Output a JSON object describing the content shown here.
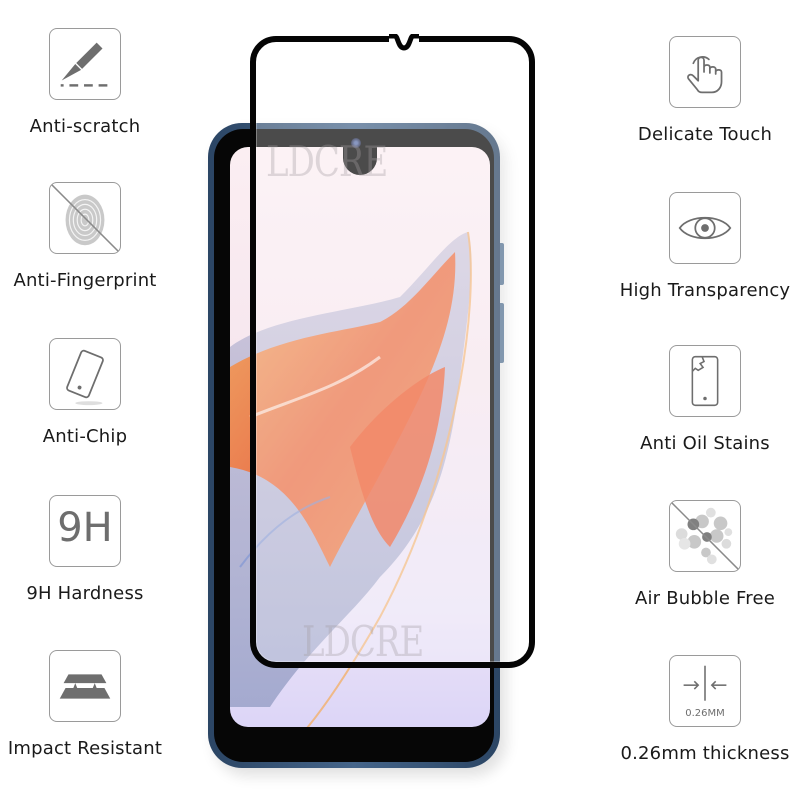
{
  "watermark": "LDCRE",
  "colors": {
    "icon_gray": "#6e6e6e",
    "icon_border": "#9a9a9a",
    "label_text": "#1a1a1a",
    "phone_frame": "#2b4564",
    "protector_edge": "#050505",
    "wallpaper_orange": "#f07a3a"
  },
  "features_left": [
    {
      "icon": "scalpel-scratch-icon",
      "label": "Anti-scratch"
    },
    {
      "icon": "crossed-fingerprint-icon",
      "label": "Anti-Fingerprint"
    },
    {
      "icon": "tilted-phone-icon",
      "label": "Anti-Chip"
    },
    {
      "icon": "9h-icon",
      "icon_text": "9H",
      "label": "9H Hardness"
    },
    {
      "icon": "layered-plates-icon",
      "label": "Impact Resistant"
    }
  ],
  "features_right": [
    {
      "icon": "touch-hand-icon",
      "label": "Delicate Touch"
    },
    {
      "icon": "eye-icon",
      "label": "High Transparency"
    },
    {
      "icon": "cracked-phone-icon",
      "label": "Anti Oil Stains"
    },
    {
      "icon": "crossed-bubbles-icon",
      "label": "Air Bubble Free"
    },
    {
      "icon": "thickness-arrows-icon",
      "icon_text": "0.26MM",
      "label": "0.26mm thickness"
    }
  ]
}
